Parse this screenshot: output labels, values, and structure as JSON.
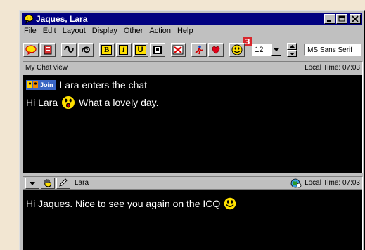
{
  "window": {
    "title": "Jaques, Lara",
    "controls": [
      "minimize-icon",
      "maximize-icon",
      "close-icon"
    ]
  },
  "menu": {
    "items": [
      {
        "pre": "",
        "u": "F",
        "post": "ile"
      },
      {
        "pre": "",
        "u": "E",
        "post": "dit"
      },
      {
        "pre": "",
        "u": "L",
        "post": "ayout"
      },
      {
        "pre": "",
        "u": "D",
        "post": "isplay"
      },
      {
        "pre": "",
        "u": "O",
        "post": "ther"
      },
      {
        "pre": "",
        "u": "A",
        "post": "ction"
      },
      {
        "pre": "",
        "u": "H",
        "post": "elp"
      }
    ]
  },
  "toolbar": {
    "bold_label": "B",
    "italic_label": "i",
    "underline_label": "U",
    "font_size": "12",
    "font_name": "MS Sans Serif",
    "step_badge": "3"
  },
  "chat_view": {
    "title": "My Chat view",
    "local_time": "Local Time: 07:03",
    "join_label": "Join",
    "line1": "Lara enters the chat",
    "line2_prefix": "Hi Lara",
    "line2_suffix": "What a lovely day."
  },
  "user_pane": {
    "user": "Lara",
    "local_time": "Local Time: 07:03",
    "message": "Hi Jaques. Nice to see you again on the ICQ"
  },
  "colors": {
    "titlebar": "#000080",
    "chat_bg": "#000000",
    "chat_text": "#ffffff",
    "badge": "#d8262c",
    "smiley": "#ffe000"
  }
}
